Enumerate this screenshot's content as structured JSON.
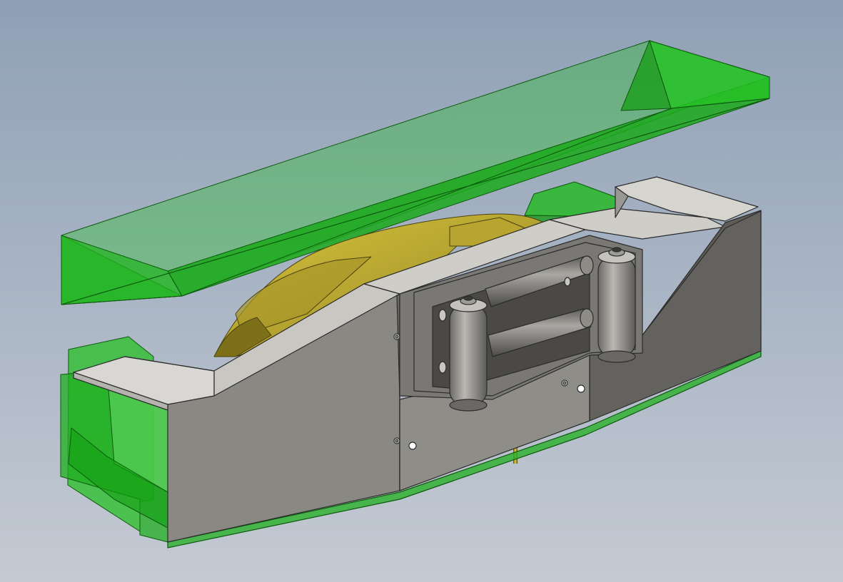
{
  "scene": {
    "background_top": "#8fa0b6",
    "background_bottom": "#c4cad3",
    "colors": {
      "steel_light": "#d8d6d2",
      "steel_mid": "#8b8984",
      "steel_dark": "#5f5d59",
      "steel_shadow": "#4a4845",
      "winch_yellow": "#c8b635",
      "winch_yellow_dark": "#8a7c1e",
      "transparent_green": "#20c020",
      "edge": "#2b2b2b"
    },
    "parts": [
      {
        "name": "upper-green-cover",
        "color": "transparent-green"
      },
      {
        "name": "left-green-mount",
        "color": "transparent-green"
      },
      {
        "name": "right-green-mount",
        "color": "transparent-green"
      },
      {
        "name": "bumper-housing",
        "color": "steel"
      },
      {
        "name": "winch-drum",
        "color": "yellow"
      },
      {
        "name": "roller-fairlead",
        "color": "steel"
      }
    ]
  }
}
